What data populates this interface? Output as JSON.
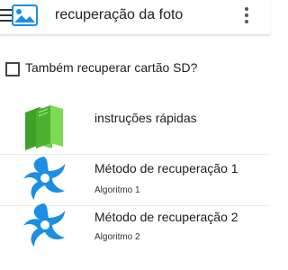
{
  "appbar": {
    "title": "recuperação da foto",
    "menu_icon": "hamburger-menu-icon",
    "app_icon": "photo-gallery-icon",
    "overflow_icon": "more-vert-icon",
    "accent": "#1a8fe3"
  },
  "sd_option": {
    "label": "Também recuperar cartão SD?",
    "checked": false
  },
  "items": [
    {
      "title": "instruções rápidas",
      "icon": "green-books-icon"
    },
    {
      "title": "Método de recuperação 1",
      "subtitle": "Algoritmo 1",
      "icon": "blue-swirl-icon"
    },
    {
      "title": "Método de recuperação 2",
      "subtitle": "Algoritmo 2",
      "icon": "blue-swirl-icon"
    }
  ],
  "colors": {
    "books_green": "#5cc23a",
    "swirl_blue": "#1a8fe3"
  }
}
